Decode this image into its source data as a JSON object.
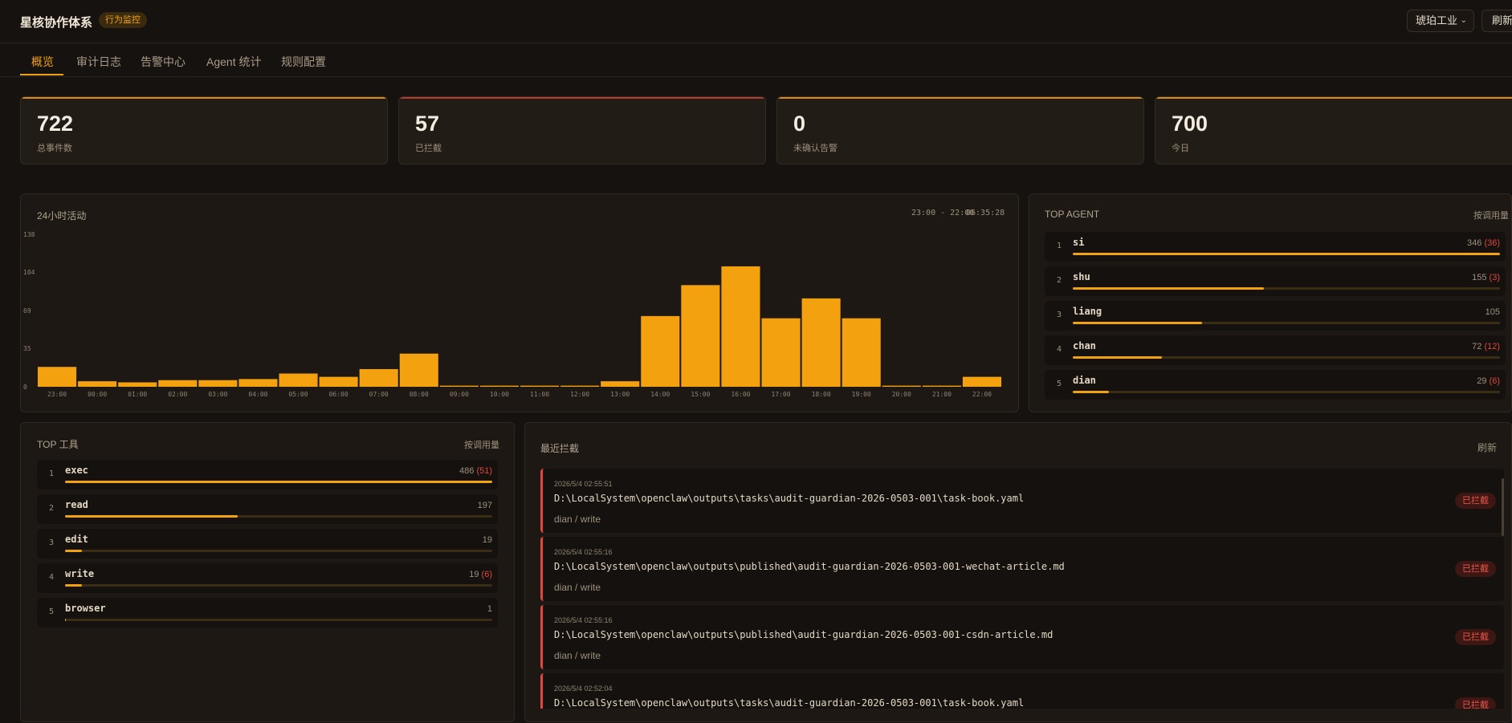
{
  "header": {
    "title": "星核协作体系",
    "badge": "行为监控",
    "factory_select": "琥珀工业",
    "refresh": "刷新"
  },
  "tabs": [
    {
      "label": "概览",
      "active": true
    },
    {
      "label": "审计日志"
    },
    {
      "label": "告警中心"
    },
    {
      "label": "Agent 统计"
    },
    {
      "label": "规则配置"
    }
  ],
  "stats": [
    {
      "value": "722",
      "label": "总事件数",
      "accent": "#d98c1a"
    },
    {
      "value": "57",
      "label": "已拦截",
      "accent": "#b23a2f"
    },
    {
      "value": "0",
      "label": "未确认告警",
      "accent": "#d98c1a"
    },
    {
      "value": "700",
      "label": "今日",
      "accent": "#d98c1a"
    }
  ],
  "activity": {
    "title": "24小时活动",
    "range": "23:00 - 22:00",
    "time": "06:35:28"
  },
  "chart_data": {
    "type": "bar",
    "categories": [
      "23:00",
      "00:00",
      "01:00",
      "02:00",
      "03:00",
      "04:00",
      "05:00",
      "06:00",
      "07:00",
      "08:00",
      "09:00",
      "10:00",
      "11:00",
      "12:00",
      "13:00",
      "14:00",
      "15:00",
      "16:00",
      "17:00",
      "18:00",
      "19:00",
      "20:00",
      "21:00",
      "22:00"
    ],
    "values": [
      18,
      5,
      4,
      6,
      6,
      7,
      12,
      9,
      16,
      30,
      1,
      1,
      1,
      1,
      5,
      64,
      92,
      109,
      62,
      80,
      62,
      1,
      1,
      9
    ],
    "ylim": [
      0,
      138
    ],
    "yticks": [
      "0",
      "35",
      "69",
      "104",
      "138"
    ],
    "color": "#f4a10f"
  },
  "top_agent": {
    "title": "TOP AGENT",
    "sort_label": "按调用量",
    "items": [
      {
        "rank": "1",
        "name": "si",
        "count": "346",
        "blocked": "(36)",
        "ratio": 1.0
      },
      {
        "rank": "2",
        "name": "shu",
        "count": "155",
        "blocked": "(3)",
        "ratio": 0.448
      },
      {
        "rank": "3",
        "name": "liang",
        "count": "105",
        "blocked": "",
        "ratio": 0.303
      },
      {
        "rank": "4",
        "name": "chan",
        "count": "72",
        "blocked": "(12)",
        "ratio": 0.208
      },
      {
        "rank": "5",
        "name": "dian",
        "count": "29",
        "blocked": "(6)",
        "ratio": 0.084
      }
    ]
  },
  "top_tools": {
    "title": "TOP 工具",
    "sort_label": "按调用量",
    "items": [
      {
        "rank": "1",
        "name": "exec",
        "count": "486",
        "blocked": "(51)",
        "ratio": 1.0
      },
      {
        "rank": "2",
        "name": "read",
        "count": "197",
        "blocked": "",
        "ratio": 0.405
      },
      {
        "rank": "3",
        "name": "edit",
        "count": "19",
        "blocked": "",
        "ratio": 0.039
      },
      {
        "rank": "4",
        "name": "write",
        "count": "19",
        "blocked": "(6)",
        "ratio": 0.039
      },
      {
        "rank": "5",
        "name": "browser",
        "count": "1",
        "blocked": "",
        "ratio": 0.002
      }
    ]
  },
  "recent_blocked": {
    "title": "最近拦截",
    "refresh": "刷新",
    "items": [
      {
        "time": "2026/5/4 02:55:51",
        "path": "D:\\LocalSystem\\openclaw\\outputs\\tasks\\audit-guardian-2026-0503-001\\task-book.yaml",
        "meta": "dian / write",
        "status": "已拦截"
      },
      {
        "time": "2026/5/4 02:55:16",
        "path": "D:\\LocalSystem\\openclaw\\outputs\\published\\audit-guardian-2026-0503-001-wechat-article.md",
        "meta": "dian / write",
        "status": "已拦截"
      },
      {
        "time": "2026/5/4 02:55:16",
        "path": "D:\\LocalSystem\\openclaw\\outputs\\published\\audit-guardian-2026-0503-001-csdn-article.md",
        "meta": "dian / write",
        "status": "已拦截"
      },
      {
        "time": "2026/5/4 02:52:04",
        "path": "D:\\LocalSystem\\openclaw\\outputs\\tasks\\audit-guardian-2026-0503-001\\task-book.yaml",
        "meta": "dian / write",
        "status": "已拦截"
      }
    ]
  }
}
